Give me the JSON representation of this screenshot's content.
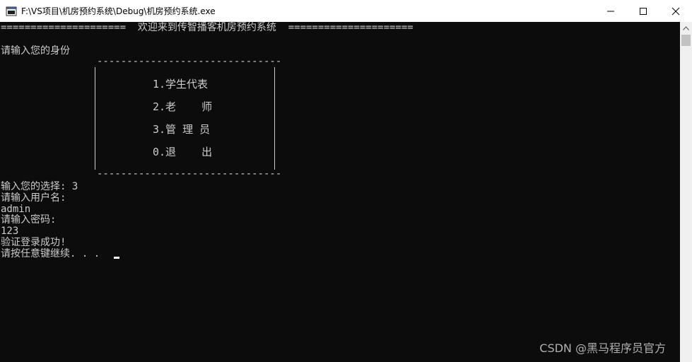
{
  "window": {
    "title": "F:\\VS项目\\机房预约系统\\Debug\\机房预约系统.exe",
    "minimize_glyph": "—",
    "maximize_glyph": "☐",
    "close_glyph": "✕",
    "icon": "console-app-icon"
  },
  "console": {
    "banner": "=====================  欢迎来到传智播客机房预约系统  =====================",
    "prompt_identity": "请输入您的身份",
    "menu_border": "-------------------------------",
    "menu_items": [
      "1.学生代表",
      "2.老    师",
      "3.管 理 员",
      "0.退    出"
    ],
    "lines": [
      "输入您的选择: 3",
      "请输入用户名:",
      "admin",
      "请输入密码:",
      "123",
      "验证登录成功!",
      "请按任意键继续. . ."
    ],
    "text_color": "#cccccc",
    "background_color": "#0c0c0c"
  },
  "watermark": "CSDN @黑马程序员官方"
}
